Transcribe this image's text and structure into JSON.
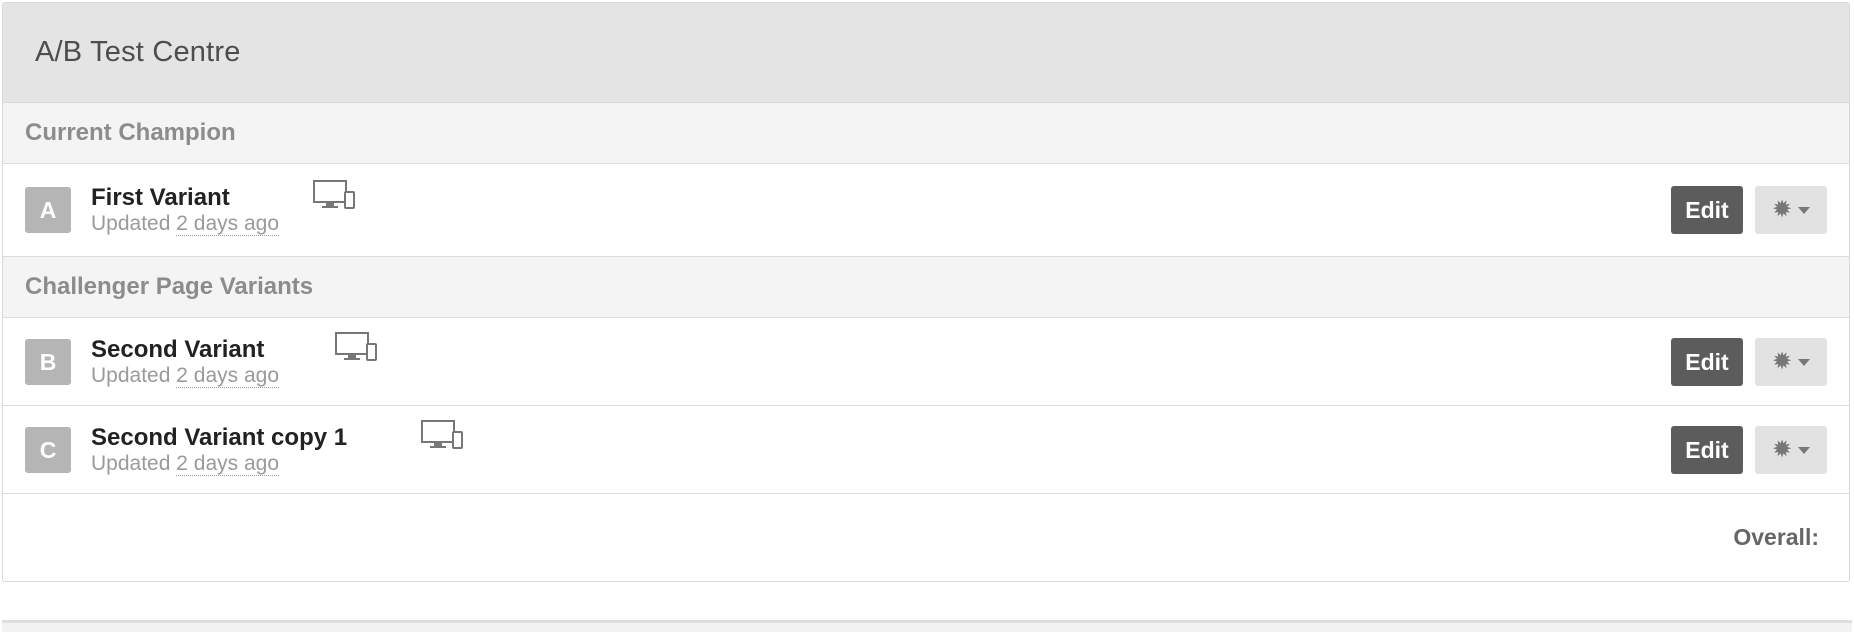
{
  "panel": {
    "title": "A/B Test Centre"
  },
  "sections": {
    "champion_label": "Current Champion",
    "challengers_label": "Challenger Page Variants"
  },
  "variants": [
    {
      "letter": "A",
      "name": "First Variant",
      "updated_prefix": "Updated",
      "updated_time": "2 days ago",
      "device_icon": "desktop-mobile-icon",
      "edit_label": "Edit",
      "settings_icon": "gear-icon"
    },
    {
      "letter": "B",
      "name": "Second Variant",
      "updated_prefix": "Updated",
      "updated_time": "2 days ago",
      "device_icon": "desktop-mobile-icon",
      "edit_label": "Edit",
      "settings_icon": "gear-icon"
    },
    {
      "letter": "C",
      "name": "Second Variant copy 1",
      "updated_prefix": "Updated",
      "updated_time": "2 days ago",
      "device_icon": "desktop-mobile-icon",
      "edit_label": "Edit",
      "settings_icon": "gear-icon"
    }
  ],
  "overall": {
    "label": "Overall:"
  },
  "colors": {
    "edit_button": "#5c5c5c",
    "settings_button": "#e2e2e2",
    "badge": "#b5b5b5",
    "header_bg": "#e4e4e4",
    "section_bg": "#f4f4f4"
  }
}
